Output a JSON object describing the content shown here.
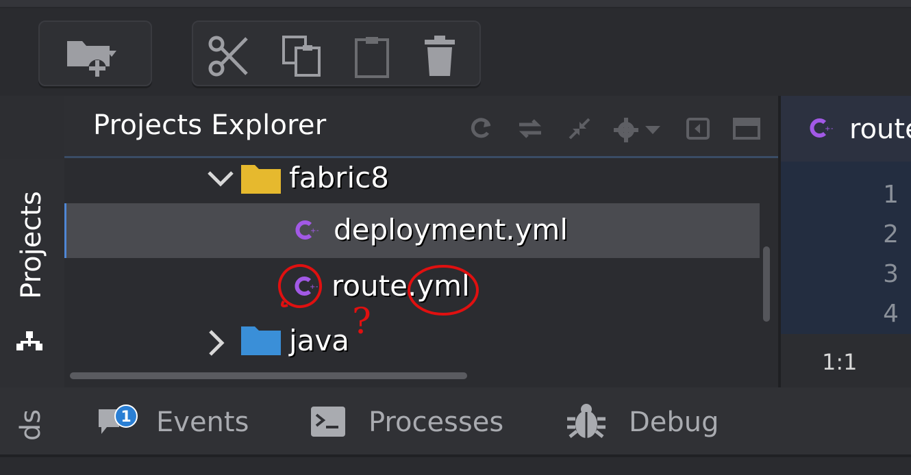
{
  "toolbar": {
    "new_folder_icon": "folder-plus-icon",
    "cut_icon": "scissors-icon",
    "copy_icon": "copy-icon",
    "paste_icon": "clipboard-icon",
    "delete_icon": "trash-icon"
  },
  "explorer": {
    "title": "Projects Explorer",
    "header_icons": [
      "refresh-icon",
      "sync-icon",
      "collapse-icon",
      "gear-icon",
      "collapse-panel-icon",
      "maximize-icon"
    ],
    "tree": [
      {
        "label": "fabric8",
        "type": "folder",
        "expanded": true,
        "folder_color": "#e6b92e"
      },
      {
        "label": "deployment.yml",
        "type": "file",
        "selected": true,
        "icon_color": "#a259e6"
      },
      {
        "label": "route.yml",
        "type": "file",
        "selected": false,
        "icon_color": "#a259e6"
      },
      {
        "label": "java",
        "type": "folder",
        "expanded": false,
        "folder_color": "#3a8fd8"
      }
    ]
  },
  "side": {
    "projects_label": "Projects",
    "other_label": "ds"
  },
  "editor": {
    "tab_label": "route",
    "line_numbers": [
      "1",
      "2",
      "3",
      "4"
    ],
    "cursor_position": "1:1"
  },
  "bottom_tabs": [
    {
      "label": "Events",
      "icon": "events-icon",
      "badge": "1"
    },
    {
      "label": "Processes",
      "icon": "terminal-icon"
    },
    {
      "label": "Debug",
      "icon": "bug-icon"
    }
  ],
  "annotation": {
    "mark": "?",
    "color": "#e01010"
  }
}
